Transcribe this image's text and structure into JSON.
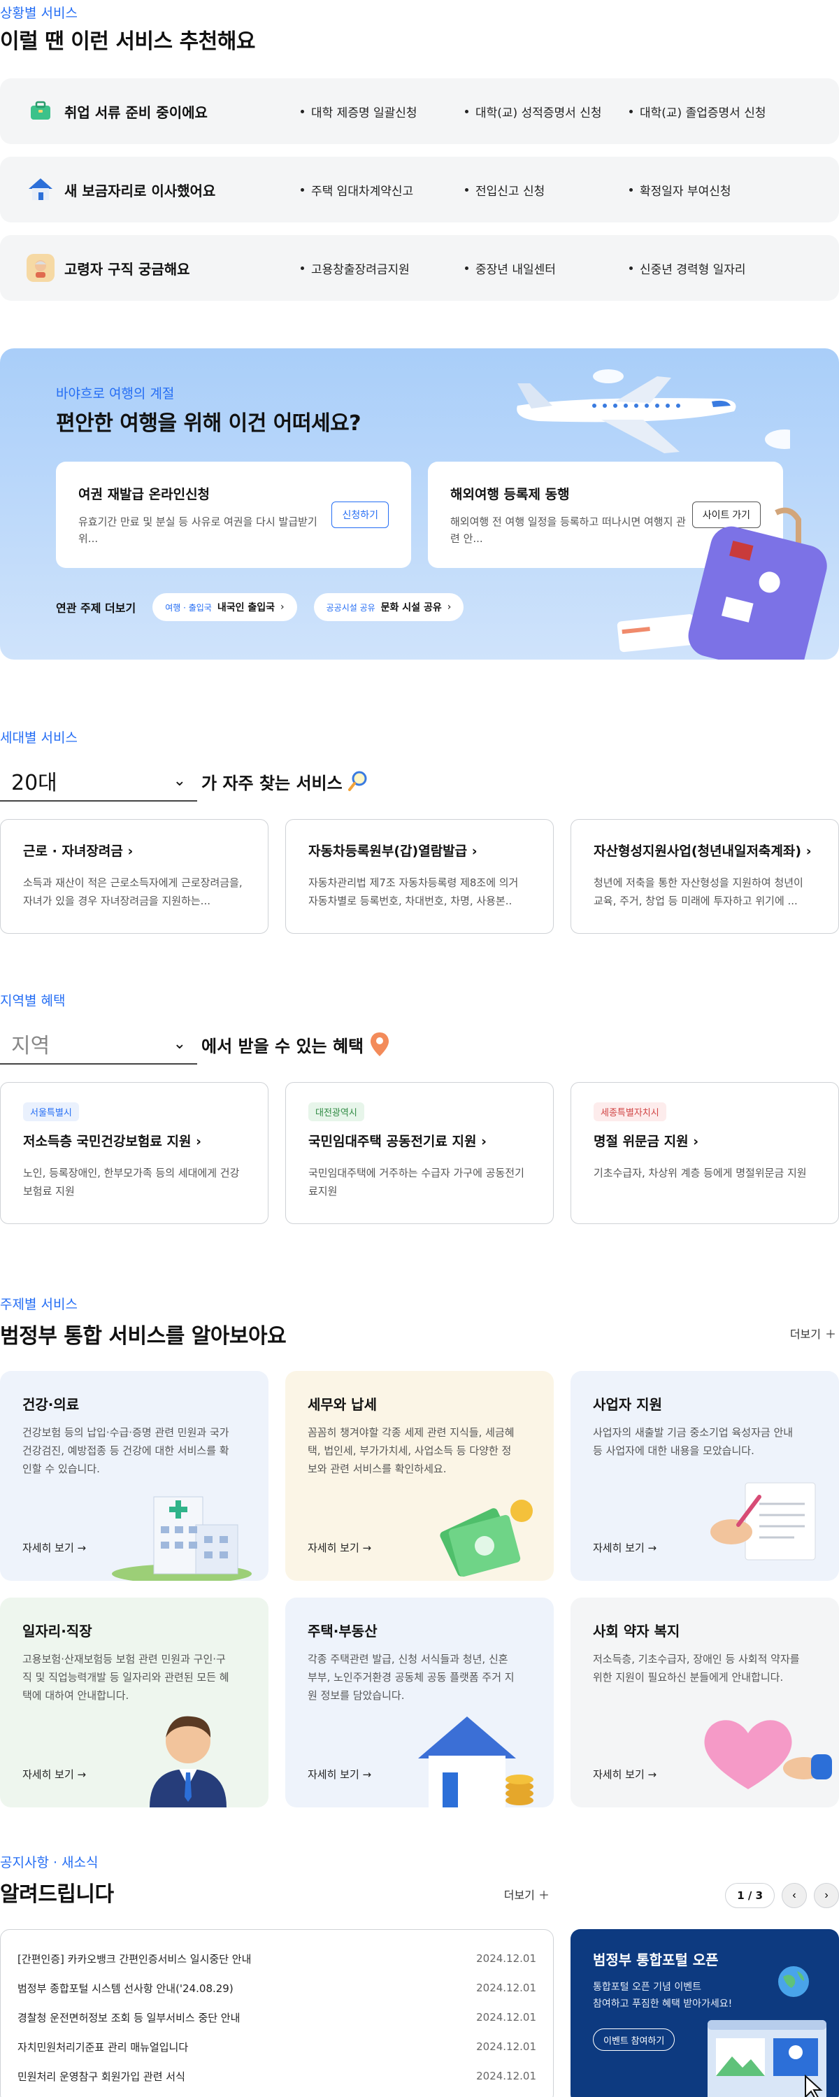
{
  "situation": {
    "eyebrow": "상황별 서비스",
    "title": "이럴 땐 이런 서비스 추천해요",
    "rows": [
      {
        "title": "취업 서류 준비 중이에요",
        "links": [
          "대학 제증명 일괄신청",
          "대학(교) 성적증명서 신청",
          "대학(교) 졸업증명서 신청"
        ]
      },
      {
        "title": "새 보금자리로 이사했어요",
        "links": [
          "주택 임대차계약신고",
          "전입신고 신청",
          "확정일자 부여신청"
        ]
      },
      {
        "title": "고령자 구직 궁금해요",
        "links": [
          "고용창출장려금지원",
          "중장년 내일센터",
          "신중년 경력형 일자리"
        ]
      }
    ]
  },
  "travel": {
    "eyebrow": "바야흐로 여행의 계절",
    "title": "편안한 여행을 위해 이건 어떠세요?",
    "cards": [
      {
        "title": "여권 재발급 온라인신청",
        "desc": "유효기간 만료 및 분실 등 사유로 여권을 다시 발급받기 위...",
        "button": "신청하기"
      },
      {
        "title": "해외여행 등록제 동행",
        "desc": "해외여행 전 여행 일정을 등록하고 떠나시면 여행지 관련 안...",
        "button": "사이트 가기"
      }
    ],
    "related_label": "연관 주제 더보기",
    "chips": [
      {
        "tag": "여행 · 출입국",
        "label": "내국인 출입국"
      },
      {
        "tag": "공공시설 공유",
        "label": "문화 시설 공유"
      }
    ]
  },
  "generation": {
    "eyebrow": "세대별 서비스",
    "selected": "20대",
    "suffix": "가 자주 찾는 서비스",
    "cards": [
      {
        "title": "근로 · 자녀장려금",
        "desc": "소득과 재산이 적은 근로소득자에게 근로장려금을, 자녀가 있을 경우 자녀장려금을 지원하는..."
      },
      {
        "title": "자동차등록원부(갑)열람발급",
        "desc": "자동차관리법 제7조 자동차등록령 제8조에 의거 자동차별로 등록번호, 차대번호, 차명, 사용본.."
      },
      {
        "title": "자산형성지원사업(청년내일저축계좌)",
        "desc": "청년에 저축을 통한 자산형성을 지원하여 청년이 교육, 주거, 창업 등 미래에 투자하고 위기에 ..."
      }
    ]
  },
  "region": {
    "eyebrow": "지역별 혜택",
    "placeholder": "지역",
    "suffix": "에서 받을 수 있는 혜택",
    "cards": [
      {
        "badge": "서울특별시",
        "title": "저소득층 국민건강보험료 지원",
        "desc": "노인, 등록장애인, 한부모가족 등의 세대에게 건강보험료 지원"
      },
      {
        "badge": "대전광역시",
        "title": "국민임대주택 공동전기료 지원",
        "desc": "국민임대주택에 거주하는 수급자 가구에 공동전기료지원"
      },
      {
        "badge": "세종특별자치시",
        "title": "명절 위문금 지원",
        "desc": "기초수급자, 차상위 계층 등에게 명절위문금 지원"
      }
    ]
  },
  "topic": {
    "eyebrow": "주제별 서비스",
    "title": "범정부 통합 서비스를 알아보아요",
    "more": "더보기",
    "link_label": "자세히 보기 →",
    "items": [
      {
        "title": "건강·의료",
        "desc": "건강보험 등의 납입·수급·증명 관련 민원과 국가건강검진, 예방접종 등 건강에 대한 서비스를 확인할 수 있습니다.",
        "bg": "#eef3fb"
      },
      {
        "title": "세무와 납세",
        "desc": "꼼꼼히 챙겨야할 각종 세제 관련 지식들, 세금혜택, 법인세, 부가가치세, 사업소득 등 다양한 정보와 관련 서비스를 확인하세요.",
        "bg": "#fbf5e6"
      },
      {
        "title": "사업자 지원",
        "desc": "사업자의 새출발 기금 중소기업 육성자금 안내 등 사업자에 대한 내용을 모았습니다.",
        "bg": "#eef3fb"
      },
      {
        "title": "일자리·직장",
        "desc": "고용보험·산재보험등 보험 관련 민원과 구인·구직 및 직업능력개발 등 일자리와 관련된 모든 혜택에 대하여 안내합니다.",
        "bg": "#eef6ee"
      },
      {
        "title": "주택·부동산",
        "desc": "각종 주택관련 발급, 신청 서식들과 청년, 신혼부부, 노인주거환경 공동체 공동 플랫폼 주거 지원 정보를 담았습니다.",
        "bg": "#eef3fb"
      },
      {
        "title": "사회 약자 복지",
        "desc": "저소득층, 기초수급자, 장애인 등 사회적 약자를 위한 지원이 필요하신 분들에게 안내합니다.",
        "bg": "#f4f5f6"
      }
    ]
  },
  "notice": {
    "eyebrow": "공지사항 · 새소식",
    "title": "알려드립니다",
    "more": "더보기",
    "page": "1 / 3",
    "rows": [
      {
        "title": "[간편인증] 카카오뱅크 간편인증서비스 일시중단 안내",
        "date": "2024.12.01"
      },
      {
        "title": "범정부 종합포털 시스템 선사항 안내('24.08.29)",
        "date": "2024.12.01"
      },
      {
        "title": "경찰청 운전면허정보 조회 등 일부서비스 중단 안내",
        "date": "2024.12.01"
      },
      {
        "title": "자치민원처리기준표 관리 매뉴얼입니다",
        "date": "2024.12.01"
      },
      {
        "title": "민원처리 운영참구 회원가입 관련 서식",
        "date": "2024.12.01"
      }
    ],
    "promo": {
      "title": "범정부 통합포털 오픈",
      "desc_line1": "통합포털 오픈 기념 이벤트",
      "desc_line2": "참여하고 푸짐한 혜택 받아가세요!",
      "button": "이벤트 참여하기"
    }
  },
  "colors": {
    "accent": "#256ef4",
    "promo_bg": "#0d3a80"
  }
}
